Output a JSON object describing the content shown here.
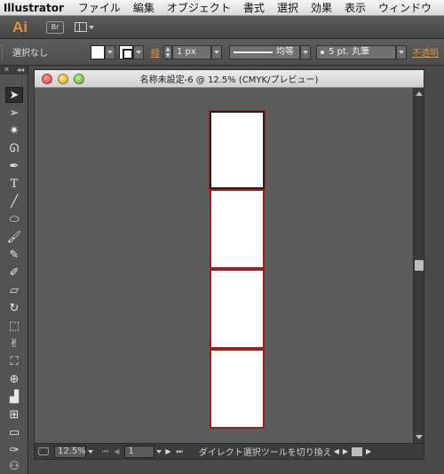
{
  "menubar": {
    "app_name": "Illustrator",
    "items": [
      "ファイル",
      "編集",
      "オブジェクト",
      "書式",
      "選択",
      "効果",
      "表示",
      "ウィンドウ"
    ]
  },
  "appbar": {
    "logo": "Ai",
    "bridge": "Br"
  },
  "control": {
    "selection": "選択なし",
    "stroke_label": "線",
    "stroke_weight": "1 px",
    "profile": "均等",
    "brush": "5 pt. 丸筆",
    "opacity_label": "不透明"
  },
  "tools": {
    "close": "✕",
    "collapse": "◂◂"
  },
  "document": {
    "title": "名称未設定-6 @ 12.5% (CMYK/プレビュー)",
    "zoom": "12.5%",
    "page": "1",
    "status": "ダイレクト選択ツールを切り換え",
    "artboard_count": 4
  },
  "colors": {
    "accent": "#e0913a",
    "artboard_border": "#a21c1c"
  }
}
